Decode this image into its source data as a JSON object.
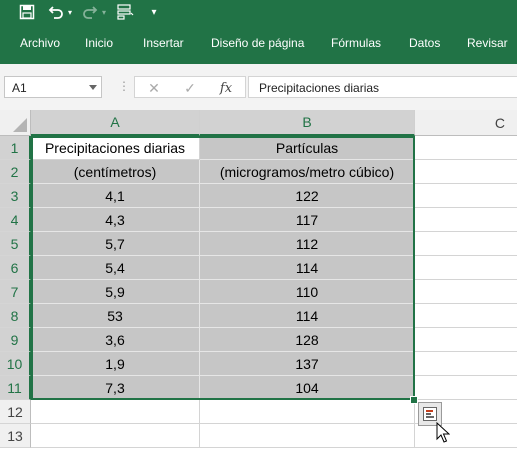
{
  "ribbon": {
    "tabs": [
      "Archivo",
      "Inicio",
      "Insertar",
      "Diseño de página",
      "Fórmulas",
      "Datos",
      "Revisar"
    ]
  },
  "formula_bar": {
    "name_box": "A1",
    "fx_label": "fx",
    "content": "Precipitaciones diarias"
  },
  "sheet": {
    "columns": [
      "A",
      "B",
      "C"
    ],
    "rows": [
      "1",
      "2",
      "3",
      "4",
      "5",
      "6",
      "7",
      "8",
      "9",
      "10",
      "11",
      "12",
      "13"
    ],
    "header": {
      "a1": "Precipitaciones diarias",
      "b1": "Partículas",
      "a2": "(centímetros)",
      "b2": "(microgramos/metro cúbico)"
    },
    "data": [
      {
        "a": "4,1",
        "b": "122"
      },
      {
        "a": "4,3",
        "b": "117"
      },
      {
        "a": "5,7",
        "b": "112"
      },
      {
        "a": "5,4",
        "b": "114"
      },
      {
        "a": "5,9",
        "b": "110"
      },
      {
        "a": "53",
        "b": "114"
      },
      {
        "a": "3,6",
        "b": "128"
      },
      {
        "a": "1,9",
        "b": "137"
      },
      {
        "a": "7,3",
        "b": "104"
      }
    ]
  },
  "colors": {
    "excel_green": "#217346",
    "selection_fill": "#c6c6c6"
  }
}
